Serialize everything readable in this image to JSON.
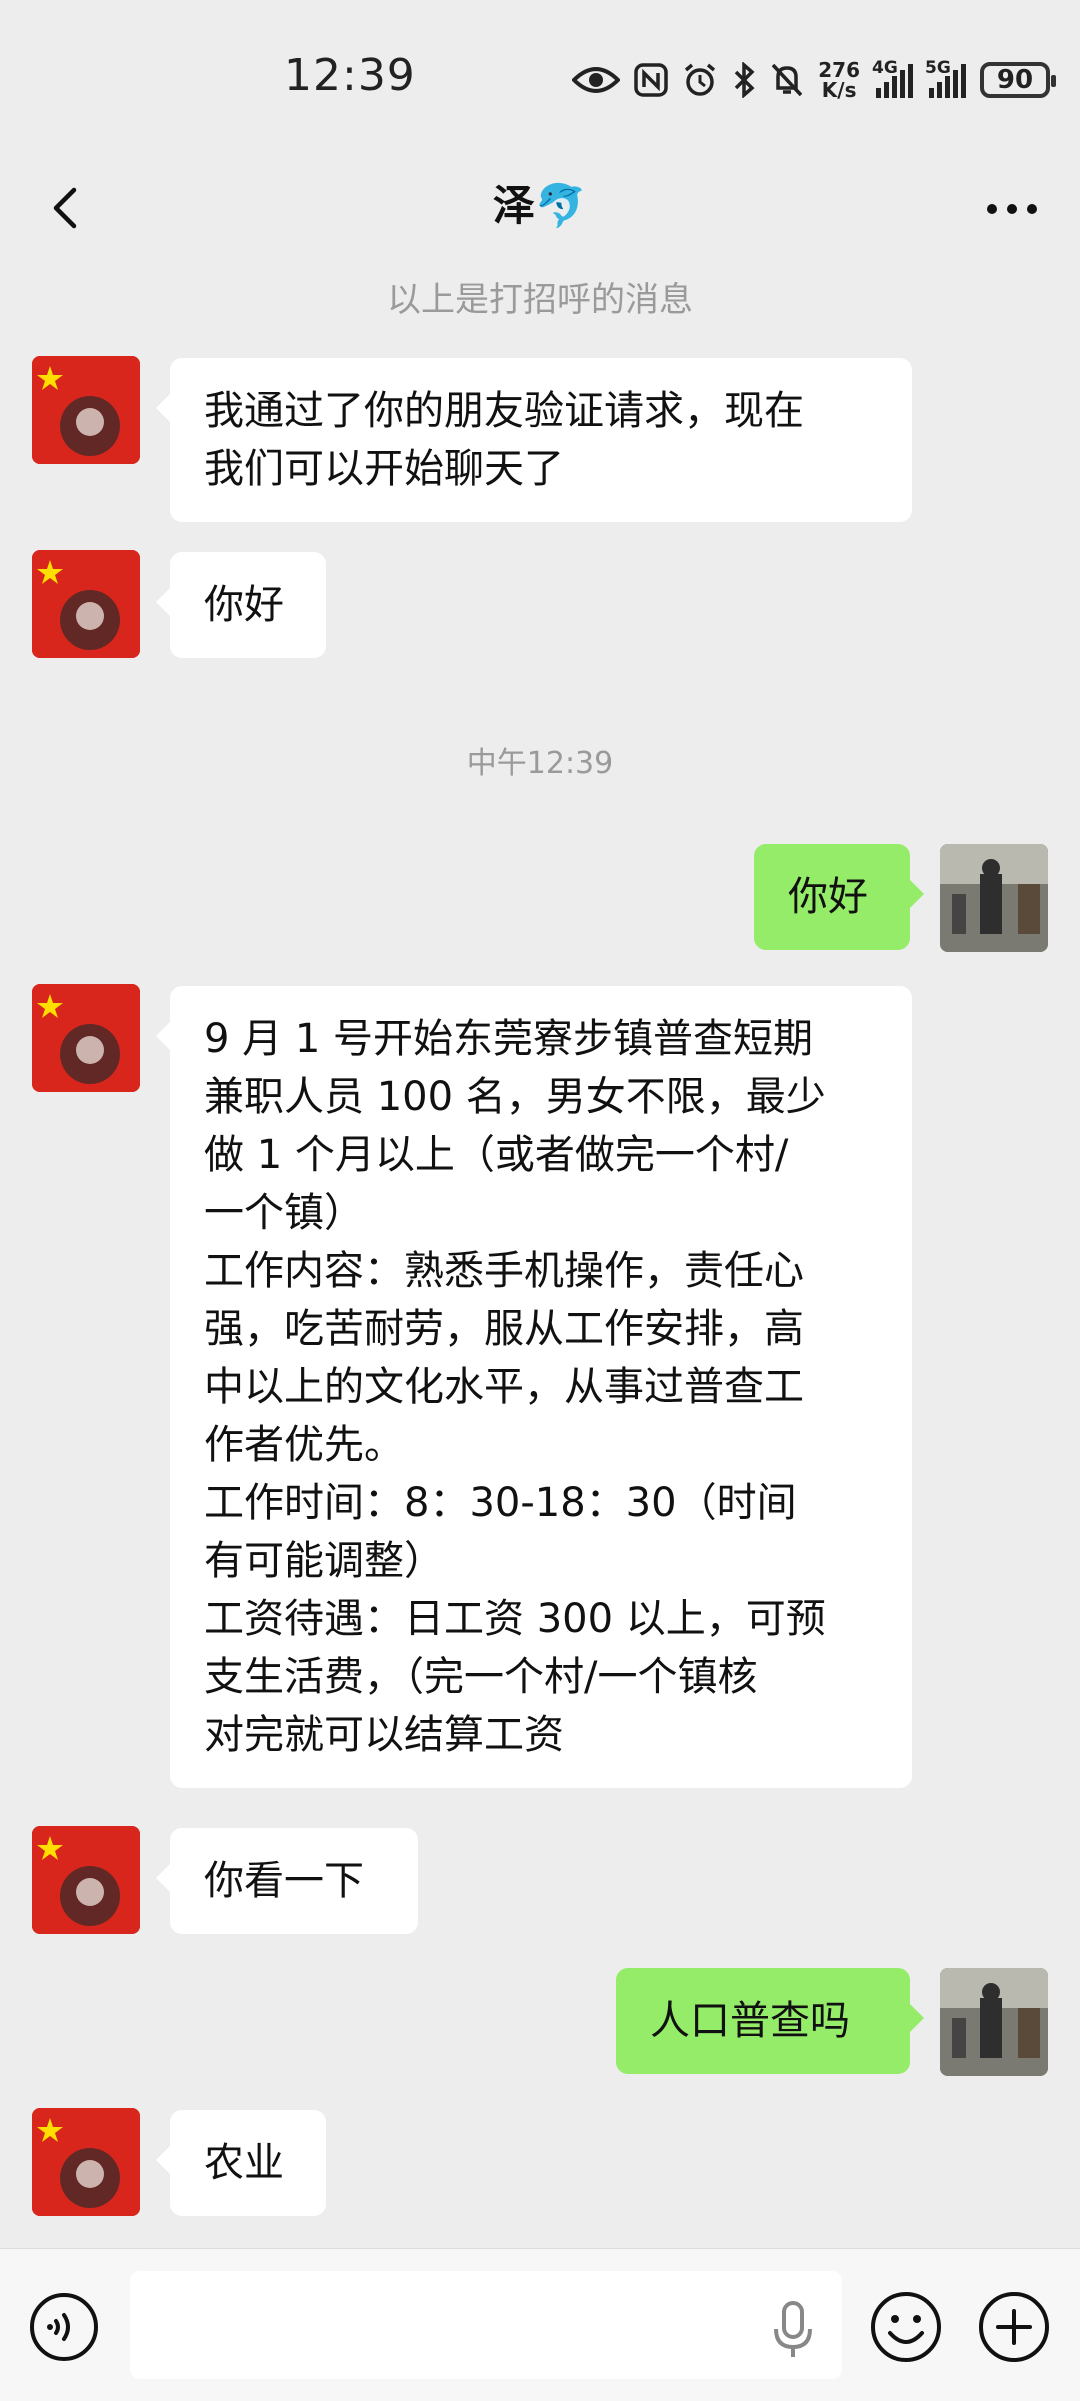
{
  "status_bar": {
    "time": "12:39",
    "net_speed_value": "276",
    "net_speed_unit": "K/s",
    "signal1_label": "4G",
    "signal2_label": "5G",
    "battery": "90"
  },
  "nav": {
    "title": "泽🐬"
  },
  "chat": {
    "greeting_notice": "以上是打招呼的消息",
    "timestamp": "中午12:39",
    "messages": [
      {
        "side": "in",
        "lines": [
          "我通过了你的朋友验证请求，现在",
          "我们可以开始聊天了"
        ]
      },
      {
        "side": "in",
        "lines": [
          "你好"
        ]
      },
      {
        "side": "out",
        "lines": [
          "你好"
        ]
      },
      {
        "side": "in",
        "lines": [
          "9 月 1 号开始东莞寮步镇普查短期",
          "兼职人员 100 名，男女不限，最少",
          "做 1 个月以上（或者做完一个村/",
          "一个镇）",
          "工作内容：熟悉手机操作，责任心",
          "强，吃苦耐劳，服从工作安排，高",
          "中以上的文化水平，从事过普查工",
          "作者优先。",
          "工作时间：8：30-18：30（时间",
          "有可能调整）",
          "工资待遇：日工资 300 以上，可预",
          "支生活费，（完一个村/一个镇核",
          "对完就可以结算工资"
        ]
      },
      {
        "side": "in",
        "lines": [
          "你看一下"
        ]
      },
      {
        "side": "out",
        "lines": [
          "人口普查吗"
        ]
      },
      {
        "side": "in",
        "lines": [
          "农业"
        ]
      }
    ]
  },
  "input": {
    "placeholder": ""
  },
  "icons": [
    "back-arrow-icon",
    "more-icon",
    "eye-icon",
    "nfc-icon",
    "alarm-icon",
    "bluetooth-icon",
    "mute-icon",
    "voice-icon",
    "mic-icon",
    "emoji-icon",
    "plus-icon"
  ]
}
